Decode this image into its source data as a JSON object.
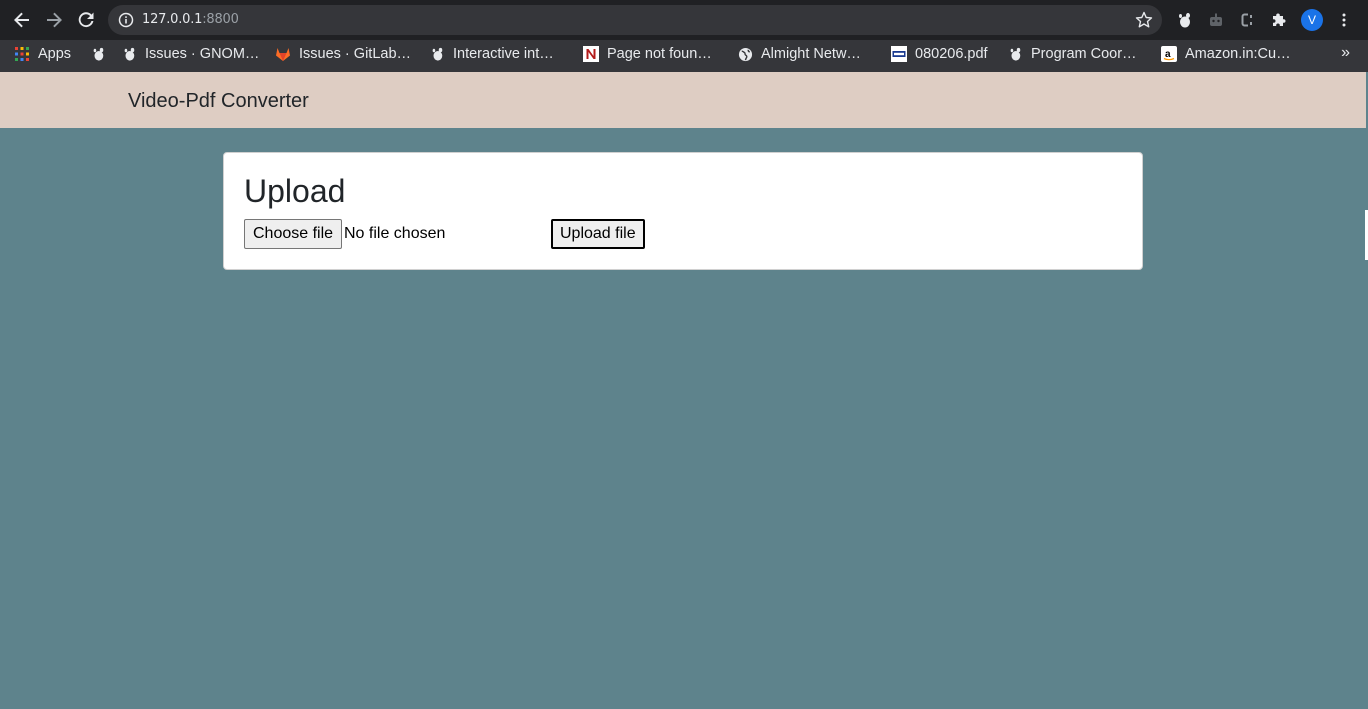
{
  "browser": {
    "url_host": "127.0.0.1",
    "url_port": ":8800",
    "avatar_letter": "V",
    "bookmarks": [
      {
        "label": "Apps",
        "icon": "apps-grid-icon"
      },
      {
        "label": "",
        "icon": "gnome-icon"
      },
      {
        "label": "Issues · GNOM…",
        "icon": "gnome-icon"
      },
      {
        "label": "Issues · GitLab…",
        "icon": "gitlab-icon"
      },
      {
        "label": "Interactive int…",
        "icon": "gnome-icon"
      },
      {
        "label": "Page not foun…",
        "icon": "n-logo-icon"
      },
      {
        "label": "Almight Netw…",
        "icon": "globe-icon"
      },
      {
        "label": "080206.pdf",
        "icon": "nec-logo-icon"
      },
      {
        "label": "Program Coor…",
        "icon": "gnome-icon"
      },
      {
        "label": "Amazon.in:Cu…",
        "icon": "amazon-icon"
      }
    ],
    "more_bookmarks": "»"
  },
  "navbar": {
    "brand": "Video-Pdf Converter"
  },
  "upload_card": {
    "title": "Upload",
    "choose_file_label": "Choose file",
    "file_status": "No file chosen",
    "upload_button_label": "Upload file"
  },
  "colors": {
    "page_background": "#5e838c",
    "navbar_background": "#decdc3",
    "card_background": "#ffffff",
    "browser_toolbar": "#202124",
    "bookmarks_bar": "#35363a"
  }
}
